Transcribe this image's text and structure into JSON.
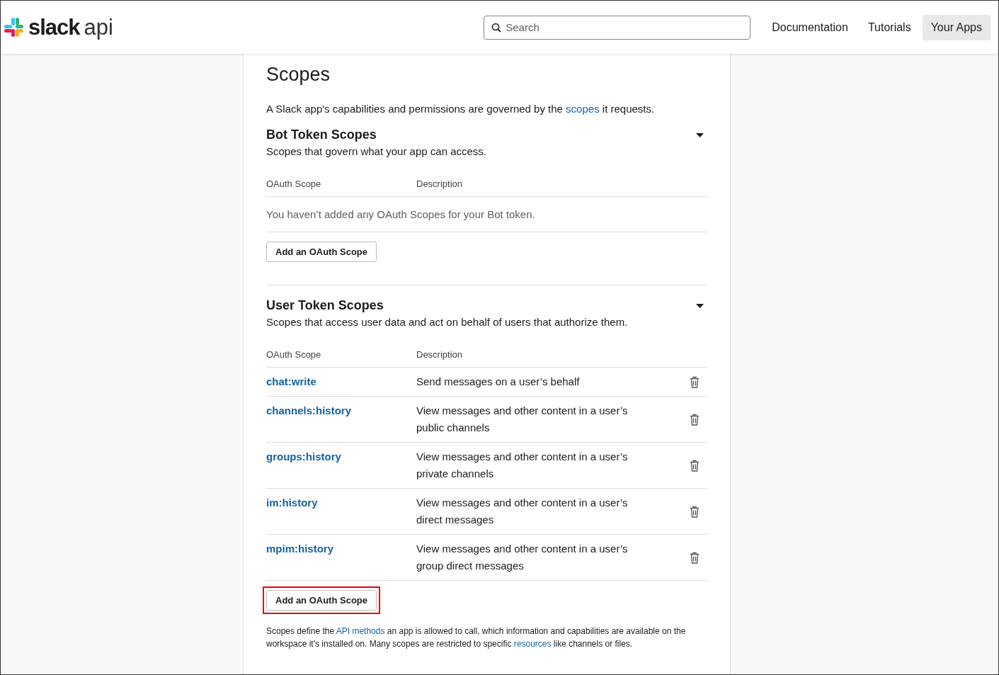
{
  "header": {
    "logo": {
      "brand": "slack",
      "product": "api"
    },
    "search": {
      "placeholder": "Search"
    },
    "nav": [
      {
        "label": "Documentation",
        "selected": false
      },
      {
        "label": "Tutorials",
        "selected": false
      },
      {
        "label": "Your Apps",
        "selected": true
      }
    ]
  },
  "page": {
    "title": "Scopes",
    "intro": [
      {
        "kind": "text",
        "text": "A Slack app's capabilities and permissions are governed by the "
      },
      {
        "kind": "link",
        "text": "scopes"
      },
      {
        "kind": "text",
        "text": " it requests."
      }
    ],
    "sections": [
      {
        "title": "Bot Token Scopes",
        "subtitle": "Scopes that govern what your app can access.",
        "expanded": true,
        "columns": [
          "OAuth Scope",
          "Description"
        ],
        "empty_message": "You haven’t added any OAuth Scopes for your Bot token.",
        "button": {
          "label": "Add an OAuth Scope",
          "highlighted": false
        }
      },
      {
        "title": "User Token Scopes",
        "subtitle": "Scopes that access user data and act on behalf of users that authorize them.",
        "expanded": true,
        "columns": [
          "OAuth Scope",
          "Description"
        ],
        "rows": [
          {
            "scope": "chat:write",
            "description": "Send messages on a user’s behalf"
          },
          {
            "scope": "channels:history",
            "description": "View messages and other content in a user’s public channels"
          },
          {
            "scope": "groups:history",
            "description": "View messages and other content in a user’s private channels"
          },
          {
            "scope": "im:history",
            "description": "View messages and other content in a user’s direct messages"
          },
          {
            "scope": "mpim:history",
            "description": "View messages and other content in a user’s group direct messages"
          }
        ],
        "button": {
          "label": "Add an OAuth Scope",
          "highlighted": true
        }
      }
    ],
    "footnote": [
      {
        "kind": "text",
        "text": "Scopes define the "
      },
      {
        "kind": "link",
        "text": "API methods"
      },
      {
        "kind": "text",
        "text": " an app is allowed to call, which information and capabilities are available on the workspace it's installed on. Many scopes are restricted to specific "
      },
      {
        "kind": "link",
        "text": "resources"
      },
      {
        "kind": "text",
        "text": " like channels or files."
      }
    ]
  }
}
